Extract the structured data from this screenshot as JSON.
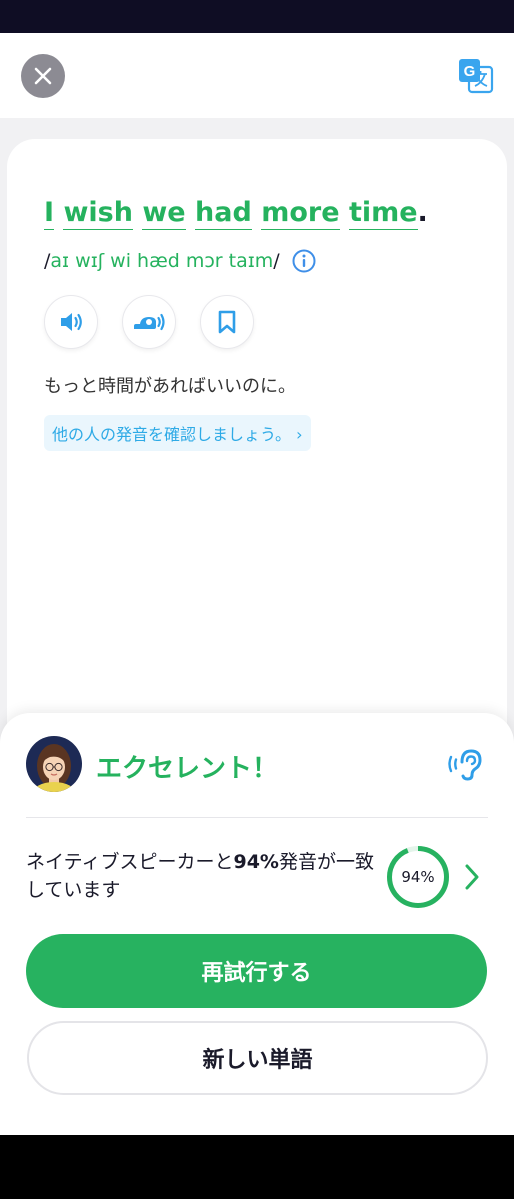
{
  "header": {
    "close_icon": "close-icon",
    "translate_icon": "translate-icon"
  },
  "sentence": {
    "words": [
      "I",
      "wish",
      "we",
      "had",
      "more",
      "time"
    ],
    "punctuation": ".",
    "phonetic_open": "/",
    "phonetic": "aɪ wɪʃ wi hæd mɔr taɪm",
    "phonetic_close": "/",
    "translation": "もっと時間があればいいのに。",
    "compare_link": "他の人の発音を確認しましょう。 ›"
  },
  "audio_controls": [
    "speaker-icon",
    "slow-speaker-icon",
    "bookmark-icon"
  ],
  "feedback": {
    "title": "エクセレント！",
    "score_text_before": "ネイティブスピーカーと",
    "score_value": "94%",
    "score_text_after": "発音が一致しています",
    "score_percent": 94,
    "score_label": "94%"
  },
  "buttons": {
    "retry": "再試行する",
    "new_word": "新しい単語"
  },
  "colors": {
    "accent_green": "#27b260",
    "link_blue": "#2eaae6",
    "info_blue": "#3f8fe8"
  }
}
